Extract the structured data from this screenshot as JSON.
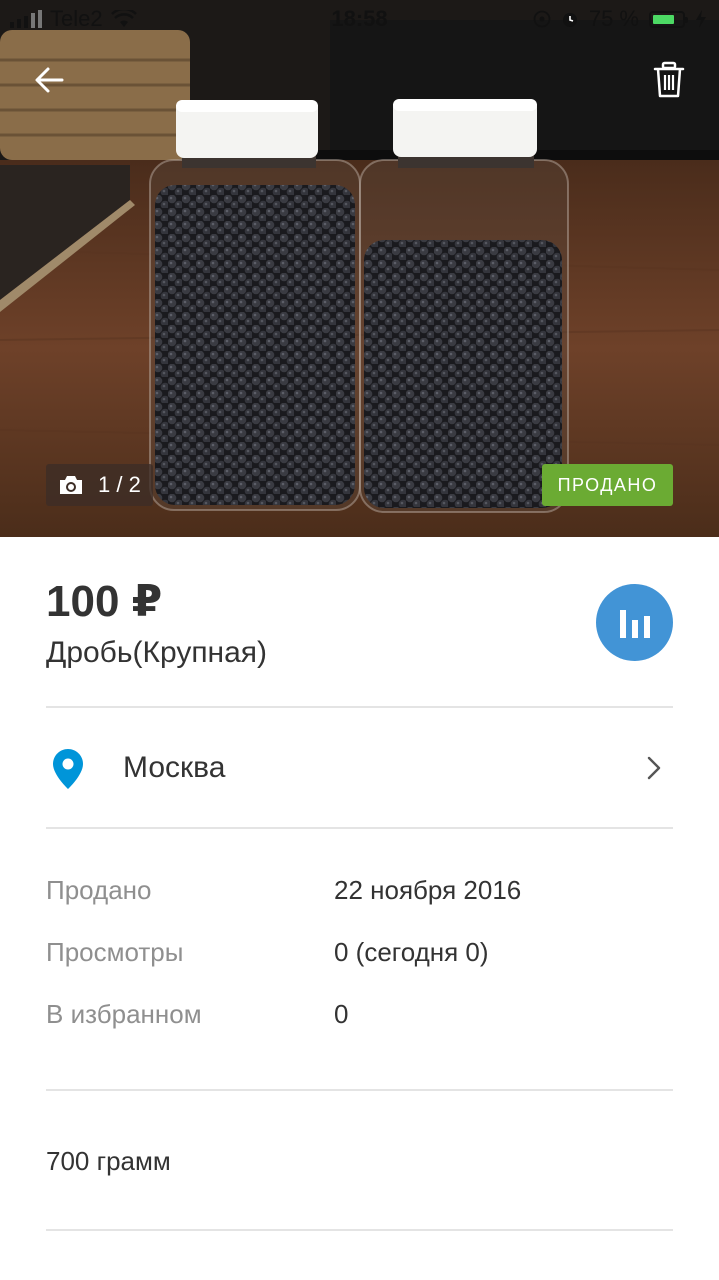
{
  "status_bar": {
    "carrier": "Tele2",
    "time": "18:58",
    "battery": "75 %"
  },
  "photo": {
    "counter": "1 / 2",
    "sold_badge": "ПРОДАНО",
    "icons": {
      "back": "arrow-left-icon",
      "delete": "trash-icon",
      "camera": "camera-icon"
    }
  },
  "listing": {
    "price": "100 ₽",
    "title": "Дробь(Крупная)",
    "stats_icon": "bar-chart-icon"
  },
  "location": {
    "city": "Москва",
    "icons": {
      "pin": "map-pin-icon",
      "chevron": "chevron-right-icon"
    }
  },
  "details": [
    {
      "label": "Продано",
      "value": "22 ноября 2016"
    },
    {
      "label": "Просмотры",
      "value": "0 (сегодня 0)"
    },
    {
      "label": "В избранном",
      "value": "0"
    }
  ],
  "description": "700 грамм",
  "colors": {
    "accent_blue": "#4294d6",
    "pin_blue": "#0095d9",
    "sold_green": "#6bab33",
    "battery_green": "#4cd964"
  }
}
